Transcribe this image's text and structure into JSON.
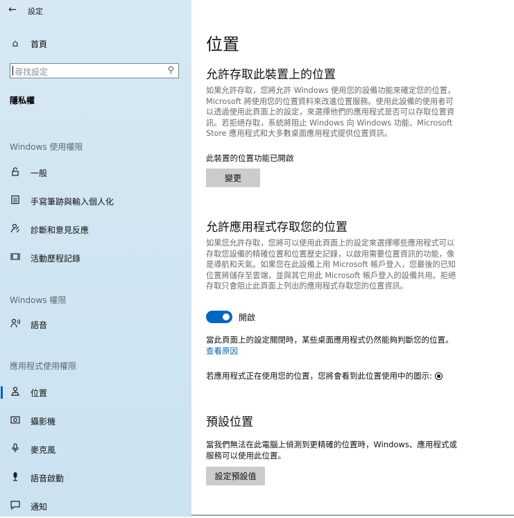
{
  "window": {
    "title": "設定",
    "back_glyph": "←"
  },
  "sidebar": {
    "home": {
      "label": "首頁",
      "icon": "home-icon",
      "glyph": "⌂"
    },
    "search": {
      "placeholder": "尋找設定",
      "icon": "search-icon",
      "glyph": "⚲"
    },
    "category": "隱私權",
    "sections": [
      {
        "title": "Windows 使用權限",
        "items": [
          {
            "label": "一般",
            "icon": "lock-icon",
            "glyph": "🔓︎"
          },
          {
            "label": "手寫筆跡與輸入個人化",
            "icon": "notepad-icon",
            "glyph": "▤"
          },
          {
            "label": "診斷和意見反應",
            "icon": "feedback-icon",
            "glyph": "☍"
          },
          {
            "label": "活動歷程記錄",
            "icon": "timeline-icon",
            "glyph": "⊞"
          }
        ]
      },
      {
        "title": "Windows 權限",
        "items": [
          {
            "label": "語音",
            "icon": "speech-icon",
            "glyph": "♮"
          }
        ]
      },
      {
        "title": "應用程式使用權限",
        "items": [
          {
            "label": "位置",
            "icon": "location-icon",
            "glyph": "♙",
            "active": true
          },
          {
            "label": "攝影機",
            "icon": "camera-icon",
            "glyph": "◙"
          },
          {
            "label": "麥克風",
            "icon": "microphone-icon",
            "glyph": "⚲"
          },
          {
            "label": "語音啟動",
            "icon": "voice-activation-icon",
            "glyph": "●"
          },
          {
            "label": "通知",
            "icon": "notification-icon",
            "glyph": "▭"
          }
        ]
      }
    ]
  },
  "main": {
    "title": "位置",
    "device_section": {
      "heading": "允許存取此裝置上的位置",
      "lines": [
        "如果允許存取，您將允許 Windows 使用您的設備功能來確定您的位置，",
        "Microsoft 將使用您的位置資料來改進位置服務。使用此設備的使用者可",
        "以透過使用此頁面上的設定，來選擇他們的應用程式是否可以存取位置資",
        "訊。若拒絕存取，系統將阻止 Windows 向 Windows 功能、Microsoft",
        "Store 應用程式和大多數桌面應用程式提供位置資訊。"
      ],
      "status": "此裝置的位置功能已開啟",
      "change_button": "變更"
    },
    "apps_section": {
      "heading": "允許應用程式存取您的位置",
      "lines": [
        "如果您允許存取，您將可以使用此頁面上的設定來選擇哪些應用程式可以",
        "存取您設備的精確位置和位置歷史記錄，以啟用需要位置資訊的功能，像",
        "是導航和天氣。如果您在此設備上用 Microsoft 帳戶登入，您最後的已知",
        "位置將儲存至雲端，並與其它用此 Microsoft 帳戶登入的設備共用。拒絕",
        "存取只會阻止此頁面上列出的應用程式存取您的位置資訊。"
      ],
      "toggle_label": "開啟",
      "toggle_on": true,
      "note": "當此頁面上的設定關閉時，某些桌面應用程式仍然能夠判斷您的位置。",
      "link": "查看原因",
      "in_use_text": "若應用程式正在使用您的位置，您將會看到此位置使用中的圖示:"
    },
    "default_section": {
      "heading": "預設位置",
      "lines": [
        "當我們無法在此電腦上偵測到更精確的位置時，Windows、應用程式或",
        "服務可以使用此位置。"
      ],
      "button": "設定預設值"
    }
  }
}
